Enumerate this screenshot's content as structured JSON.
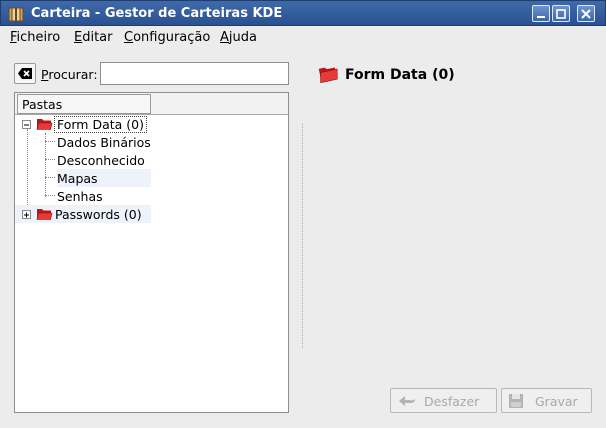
{
  "window": {
    "title": "Carteira - Gestor de Carteiras KDE"
  },
  "menu": [
    {
      "mnemonic": "F",
      "rest": "icheiro"
    },
    {
      "mnemonic": "E",
      "rest": "ditar"
    },
    {
      "mnemonic": "C",
      "rest": "onfiguração"
    },
    {
      "mnemonic": "A",
      "rest": "juda"
    }
  ],
  "search": {
    "label_mnemonic": "P",
    "label_rest": "rocurar:",
    "value": ""
  },
  "tree": {
    "column_header": "Pastas",
    "folders": [
      {
        "label": "Form Data (0)",
        "expanded": true,
        "children": [
          "Dados Binários",
          "Desconhecido",
          "Mapas",
          "Senhas"
        ]
      },
      {
        "label": "Passwords (0)",
        "expanded": false
      }
    ]
  },
  "detail": {
    "title": "Form Data (0)"
  },
  "buttons": {
    "undo": "Desfazer",
    "save": "Gravar"
  },
  "colors": {
    "titlebar": "#2f5a9c",
    "folder_red": "#d42020",
    "background": "#ececec"
  }
}
